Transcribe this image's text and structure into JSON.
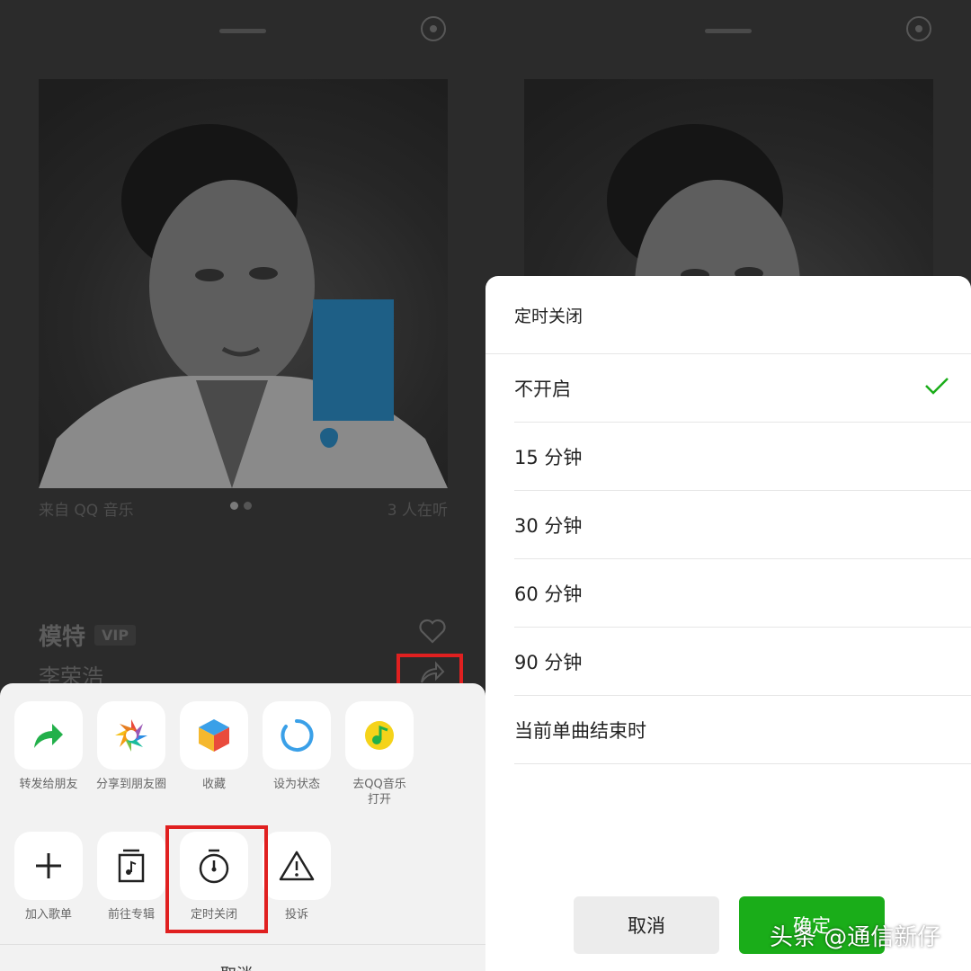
{
  "left": {
    "cover_meta": {
      "source": "来自 QQ 音乐",
      "listeners": "3 人在听"
    },
    "song": {
      "title": "模特",
      "vip_badge": "VIP",
      "artist": "李荣浩"
    },
    "share_sheet": {
      "row1": [
        {
          "label": "转发给朋友",
          "icon": "forward-icon"
        },
        {
          "label": "分享到朋友圈",
          "icon": "moments-icon"
        },
        {
          "label": "收藏",
          "icon": "favorite-cube-icon"
        },
        {
          "label": "设为状态",
          "icon": "status-ring-icon"
        },
        {
          "label": "去QQ音乐打开",
          "icon": "qq-music-icon"
        }
      ],
      "row2": [
        {
          "label": "加入歌单",
          "icon": "plus-icon"
        },
        {
          "label": "前往专辑",
          "icon": "album-icon"
        },
        {
          "label": "定时关闭",
          "icon": "timer-icon"
        },
        {
          "label": "投诉",
          "icon": "warning-icon"
        }
      ],
      "cancel_label": "取消"
    },
    "colors": {
      "highlight": "#e02020"
    }
  },
  "right": {
    "dialog": {
      "title": "定时关闭",
      "options": [
        "不开启",
        "15 分钟",
        "30 分钟",
        "60 分钟",
        "90 分钟",
        "当前单曲结束时"
      ],
      "selected_index": 0,
      "cancel_label": "取消",
      "confirm_label": "确定"
    },
    "colors": {
      "confirm": "#1aad19",
      "check": "#1aad19"
    }
  },
  "watermark": "头条 @通信新仔"
}
